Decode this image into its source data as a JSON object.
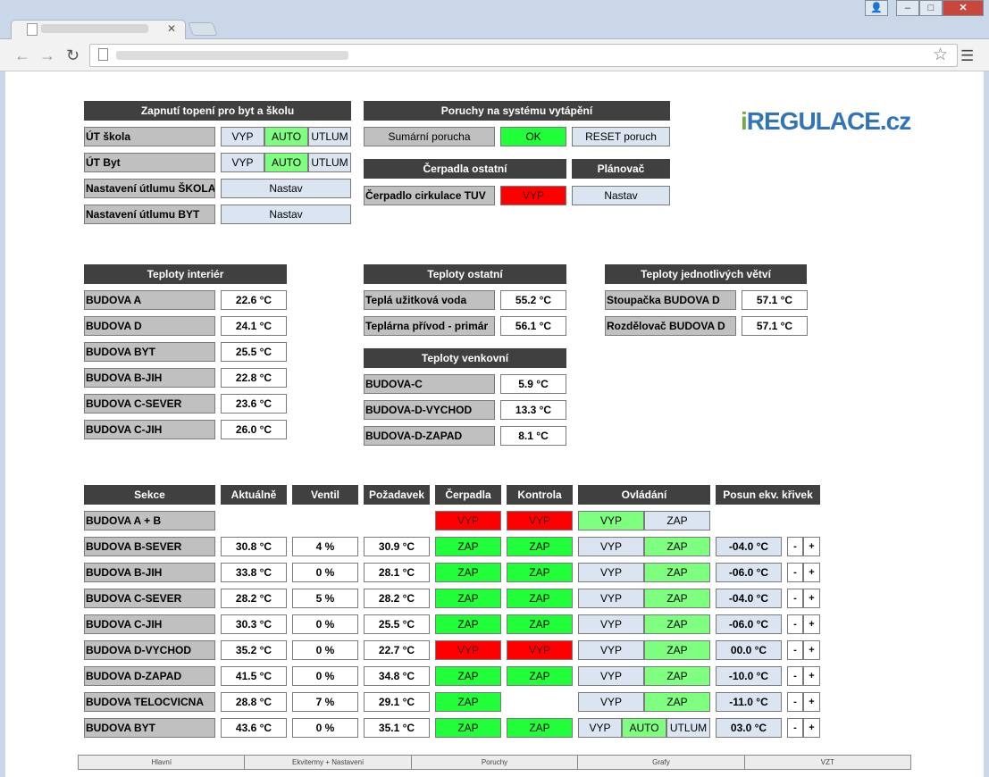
{
  "browser": {
    "min_label": "–",
    "max_label": "□",
    "close_label": "✕",
    "user_label": "👤"
  },
  "heating": {
    "header": "Zapnutí topení pro byt a školu",
    "ut_skola": "ÚT škola",
    "ut_byt": "ÚT Byt",
    "utlum_skola": "Nastavení útlumu ŠKOLA",
    "utlum_byt": "Nastavení útlumu BYT",
    "vyp": "VYP",
    "auto": "AUTO",
    "utlum": "UTLUM",
    "nastav": "Nastav"
  },
  "faults": {
    "header": "Poruchy na systému vytápění",
    "summary_label": "Sumární porucha",
    "status": "OK",
    "reset": "RESET poruch"
  },
  "pumps": {
    "header": "Čerpadla ostatní",
    "tuv_label": "Čerpadlo cirkulace TUV",
    "tuv_state": "VYP"
  },
  "planner": {
    "header": "Plánovač",
    "button": "Nastav"
  },
  "logo": {
    "i": "i",
    "main": "REGULACE",
    "tld": ".cz"
  },
  "interior": {
    "header": "Teploty interiér",
    "rows": [
      {
        "label": "BUDOVA A",
        "value": "22.6 °C"
      },
      {
        "label": "BUDOVA D",
        "value": "24.1 °C"
      },
      {
        "label": "BUDOVA BYT",
        "value": "25.5 °C"
      },
      {
        "label": "BUDOVA B-JIH",
        "value": "22.8 °C"
      },
      {
        "label": "BUDOVA C-SEVER",
        "value": "23.6 °C"
      },
      {
        "label": "BUDOVA C-JIH",
        "value": "26.0 °C"
      }
    ]
  },
  "other_temps": {
    "header": "Teploty ostatní",
    "rows": [
      {
        "label": "Teplá užitková voda",
        "value": "55.2 °C"
      },
      {
        "label": "Teplárna přívod - primár",
        "value": "56.1 °C"
      }
    ]
  },
  "outdoor": {
    "header": "Teploty venkovní",
    "rows": [
      {
        "label": "BUDOVA-C",
        "value": "5.9 °C"
      },
      {
        "label": "BUDOVA-D-VYCHOD",
        "value": "13.3 °C"
      },
      {
        "label": "BUDOVA-D-ZAPAD",
        "value": "8.1 °C"
      }
    ]
  },
  "branches": {
    "header": "Teploty jednotlivých větví",
    "rows": [
      {
        "label": "Stoupačka BUDOVA D",
        "value": "57.1 °C"
      },
      {
        "label": "Rozdělovač BUDOVA D",
        "value": "57.1 °C"
      }
    ]
  },
  "sections": {
    "headers": {
      "sekce": "Sekce",
      "aktualne": "Aktuálně",
      "ventil": "Ventil",
      "pozadavek": "Požadavek",
      "cerpadla": "Čerpadla",
      "kontrola": "Kontrola",
      "ovladani": "Ovládání",
      "posun": "Posun ekv. křivek"
    },
    "rows": [
      {
        "name": "BUDOVA A + B",
        "actual": "",
        "valve": "",
        "request": "",
        "pump": "VYP",
        "check": "VYP",
        "mode": "AB",
        "shift": ""
      },
      {
        "name": "BUDOVA B-SEVER",
        "actual": "30.8 °C",
        "valve": "4 %",
        "request": "30.9 °C",
        "pump": "ZAP",
        "check": "ZAP",
        "mode": "2",
        "shift": "-04.0 °C"
      },
      {
        "name": "BUDOVA B-JIH",
        "actual": "33.8 °C",
        "valve": "0 %",
        "request": "28.1 °C",
        "pump": "ZAP",
        "check": "ZAP",
        "mode": "2",
        "shift": "-06.0 °C"
      },
      {
        "name": "BUDOVA C-SEVER",
        "actual": "28.2 °C",
        "valve": "5 %",
        "request": "28.2 °C",
        "pump": "ZAP",
        "check": "ZAP",
        "mode": "2",
        "shift": "-04.0 °C"
      },
      {
        "name": "BUDOVA C-JIH",
        "actual": "30.3 °C",
        "valve": "0 %",
        "request": "25.5 °C",
        "pump": "ZAP",
        "check": "ZAP",
        "mode": "2",
        "shift": "-06.0 °C"
      },
      {
        "name": "BUDOVA D-VYCHOD",
        "actual": "35.2 °C",
        "valve": "0 %",
        "request": "22.7 °C",
        "pump": "VYP",
        "check": "VYP",
        "mode": "2",
        "shift": "00.0 °C"
      },
      {
        "name": "BUDOVA D-ZAPAD",
        "actual": "41.5 °C",
        "valve": "0 %",
        "request": "34.8 °C",
        "pump": "ZAP",
        "check": "ZAP",
        "mode": "2",
        "shift": "-10.0 °C"
      },
      {
        "name": "BUDOVA TELOCVICNA",
        "actual": "28.8 °C",
        "valve": "7 %",
        "request": "29.1 °C",
        "pump": "ZAP",
        "check": "",
        "mode": "2",
        "shift": "-11.0 °C"
      },
      {
        "name": "BUDOVA BYT",
        "actual": "43.6 °C",
        "valve": "0 %",
        "request": "35.1 °C",
        "pump": "ZAP",
        "check": "ZAP",
        "mode": "3",
        "shift": "03.0 °C"
      }
    ],
    "vyp": "VYP",
    "zap": "ZAP",
    "auto": "AUTO",
    "utlum": "UTLUM",
    "minus": "-",
    "plus": "+"
  },
  "footer": [
    "Hlavní",
    "Ekvitermy + Nastavení",
    "Poruchy",
    "Grafy",
    "VZT"
  ],
  "colors": {
    "header_bg": "#404040",
    "label_bg": "#c0c0c0",
    "blue_btn": "#dbe5f1",
    "green_on": "#21ff3a",
    "light_green": "#7fff7f",
    "red_off": "#ff0000",
    "logo_green": "#6fae3d",
    "logo_blue": "#3274b8"
  }
}
